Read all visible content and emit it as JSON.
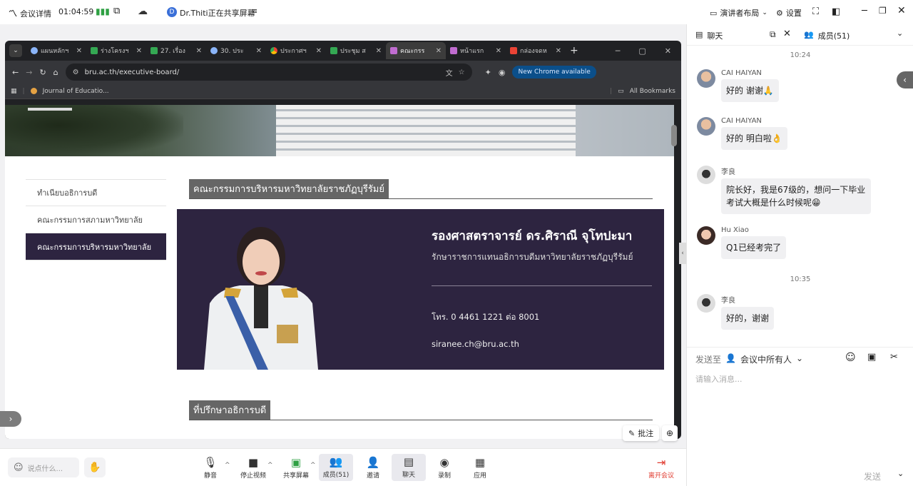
{
  "topbar": {
    "meeting_info": "会议详情",
    "timer": "01:04:59",
    "sharer_avatar_letter": "D",
    "sharing_text": "Dr.Thiti正在共享屏幕",
    "layout_label": "演讲者布局",
    "settings_label": "设置"
  },
  "browser": {
    "tabs": [
      {
        "label": "แผนหลักฯ",
        "color": "#8ab4f8"
      },
      {
        "label": "ร่างโครงฯ",
        "color": "#34a853"
      },
      {
        "label": "27. เรื่อง",
        "color": "#34a853"
      },
      {
        "label": "30. ประ",
        "color": "#8ab4f8"
      },
      {
        "label": "ประกาศฯ",
        "color": "#ea4335"
      },
      {
        "label": "ประชุม ส",
        "color": "#34a853"
      },
      {
        "label": "คณะกรร",
        "color": "#c06cd0"
      },
      {
        "label": "หน้าแรก",
        "color": "#c06cd0"
      },
      {
        "label": "กล่องจดห",
        "color": "#ea4335"
      }
    ],
    "url": "bru.ac.th/executive-board/",
    "new_chrome": "New Chrome available",
    "bookmark": "Journal of Educatio...",
    "all_bookmarks": "All Bookmarks"
  },
  "website": {
    "menu": [
      "ทำเนียบอธิการบดี",
      "คณะกรรมการสภามหาวิทยาลัย",
      "คณะกรรมการบริหารมหาวิทยาลัย"
    ],
    "section_title": "คณะกรรมการบริหารมหาวิทยาลัยราชภัฏบุรีรัมย์",
    "person_name": "รองศาสตราจารย์ ดร.ศิราณี จุโทปะมา",
    "person_role": "รักษาราชการแทนอธิการบดีมหาวิทยาลัยราชภัฏบุรีรัมย์",
    "phone": "โทร. 0 4461 1221 ต่อ 8001",
    "email": "siranee.ch@bru.ac.th",
    "section2_title": "ที่ปรึกษาอธิการบดี",
    "annotate": "批注"
  },
  "chat": {
    "tab_chat": "聊天",
    "tab_members": "成员(51)",
    "time1": "10:24",
    "time2": "10:35",
    "messages": [
      {
        "sender": "CAI HAIYAN",
        "text": "好的 谢谢🙏"
      },
      {
        "sender": "CAI HAIYAN",
        "text": "好的 明白啦👌"
      },
      {
        "sender": "李良",
        "text": "院长好，我是67级的，想问一下毕业考试大概是什么时候呢😁"
      },
      {
        "sender": "Hu Xiao",
        "text": "Q1已经考完了"
      },
      {
        "sender": "李良",
        "text": "好的，谢谢"
      }
    ],
    "send_to_label": "发送至",
    "send_to_target": "会议中所有人",
    "placeholder": "请输入消息...",
    "send": "发送"
  },
  "bottombar": {
    "say_something": "说点什么...",
    "buttons": [
      "静音",
      "停止视频",
      "共享屏幕",
      "成员(51)",
      "邀请",
      "聊天",
      "录制",
      "应用"
    ],
    "leave": "离开会议"
  }
}
